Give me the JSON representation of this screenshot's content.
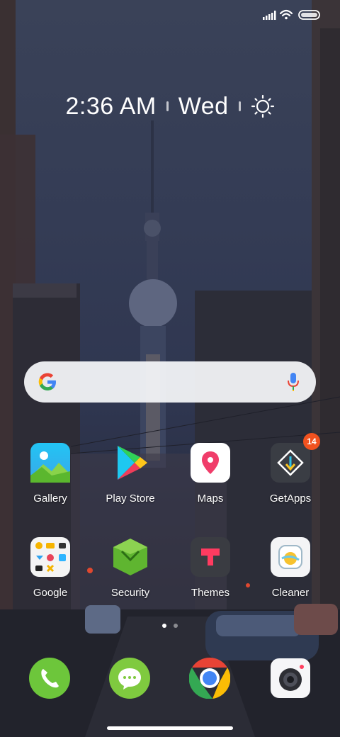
{
  "status": {
    "signal_icon": "signal-bars-icon",
    "wifi_icon": "wifi-icon",
    "battery_icon": "battery-icon"
  },
  "clock": {
    "time": "2:36 AM",
    "day": "Wed",
    "weather_icon": "sun-icon"
  },
  "search": {
    "logo_icon": "google-g-icon",
    "mic_icon": "microphone-icon"
  },
  "apps": [
    {
      "label": "Gallery",
      "icon": "gallery-icon"
    },
    {
      "label": "Play Store",
      "icon": "play-store-icon"
    },
    {
      "label": "Maps",
      "icon": "maps-pin-icon"
    },
    {
      "label": "GetApps",
      "icon": "getapps-icon",
      "badge": "14"
    },
    {
      "label": "Google",
      "icon": "google-folder-icon"
    },
    {
      "label": "Security",
      "icon": "security-shield-icon"
    },
    {
      "label": "Themes",
      "icon": "themes-brush-icon"
    },
    {
      "label": "Cleaner",
      "icon": "cleaner-icon"
    }
  ],
  "page_indicator": {
    "pages": 2,
    "current": 1
  },
  "dock": [
    {
      "icon": "phone-icon"
    },
    {
      "icon": "messages-icon"
    },
    {
      "icon": "chrome-icon"
    },
    {
      "icon": "camera-icon"
    }
  ],
  "colors": {
    "badge": "#f2521f",
    "phone_green": "#6dc63b",
    "maps_pink": "#f03d6a"
  }
}
